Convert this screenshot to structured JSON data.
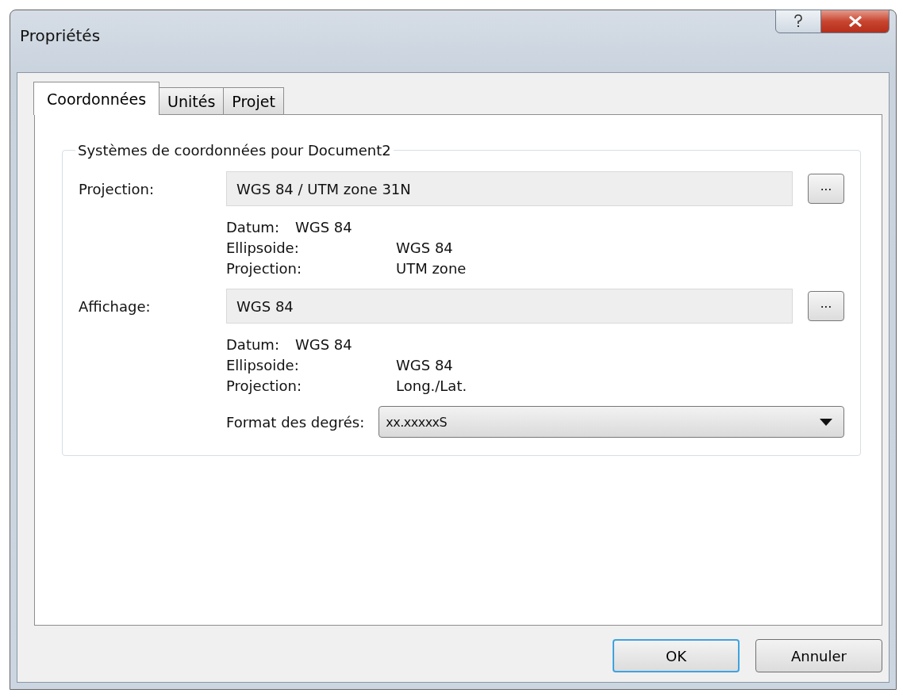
{
  "window": {
    "title": "Propriétés"
  },
  "tabs": [
    {
      "label": "Coordonnées",
      "selected": true
    },
    {
      "label": "Unités",
      "selected": false
    },
    {
      "label": "Projet",
      "selected": false
    }
  ],
  "group": {
    "title": "Systèmes de coordonnées pour Document2",
    "systems": [
      {
        "label": "Projection:",
        "value": "WGS 84 / UTM zone 31N",
        "browse": "...",
        "details": [
          {
            "kind": "inline",
            "label": "Datum:",
            "value": "WGS 84"
          },
          {
            "kind": "column",
            "label": "Ellipsoide:",
            "value": "WGS 84"
          },
          {
            "kind": "column",
            "label": "Projection:",
            "value": "UTM zone"
          }
        ]
      },
      {
        "label": "Affichage:",
        "value": "WGS 84",
        "browse": "...",
        "details": [
          {
            "kind": "inline",
            "label": "Datum:",
            "value": "WGS 84"
          },
          {
            "kind": "column",
            "label": "Ellipsoide:",
            "value": "WGS 84"
          },
          {
            "kind": "column",
            "label": "Projection:",
            "value": "Long./Lat."
          }
        ]
      }
    ],
    "degree_format": {
      "label": "Format des degrés:",
      "value": "xx.xxxxxS"
    }
  },
  "buttons": [
    {
      "label": "OK",
      "default": true
    },
    {
      "label": "Annuler",
      "default": false
    }
  ]
}
